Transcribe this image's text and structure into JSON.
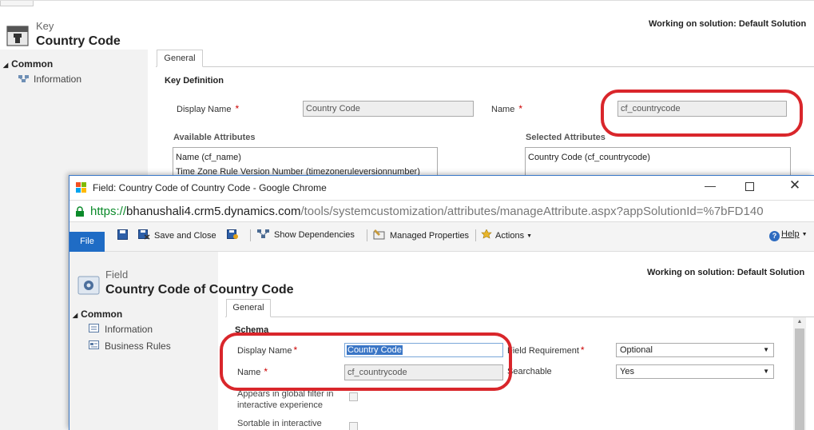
{
  "bg": {
    "entity_label": "Key",
    "title": "Country Code",
    "solution_text": "Working on solution: Default Solution",
    "nav_section": "Common",
    "nav_items": [
      "Information"
    ],
    "tab": "General",
    "section_title": "Key Definition",
    "display_name_label": "Display Name",
    "display_name_value": "Country Code",
    "name_label": "Name",
    "name_value": "cf_countrycode",
    "available_label": "Available Attributes",
    "available_items": [
      "Name (cf_name)",
      "Time Zone Rule Version Number (timezoneruleversionnumber)"
    ],
    "selected_label": "Selected Attributes",
    "selected_items": [
      "Country Code (cf_countrycode)"
    ],
    "required_marker": "*"
  },
  "popup": {
    "window_title": "Field: Country Code of Country Code - Google Chrome",
    "url_scheme": "https://",
    "url_host": "bhanushali4.crm5.dynamics.com",
    "url_path": "/tools/systemcustomization/attributes/manageAttribute.aspx?appSolutionId=%7bFD140",
    "toolbar": {
      "file": "File",
      "save_close": "Save and Close",
      "show_dependencies": "Show Dependencies",
      "managed_properties": "Managed Properties",
      "actions": "Actions",
      "help": "Help"
    },
    "entity_label": "Field",
    "title": "Country Code of Country Code",
    "solution_text": "Working on solution: Default Solution",
    "nav_section": "Common",
    "nav_items": [
      "Information",
      "Business Rules"
    ],
    "tab": "General",
    "section_title": "Schema",
    "display_name_label": "Display Name",
    "display_name_value": "Country Code",
    "name_label": "Name",
    "name_value": "cf_countrycode",
    "field_requirement_label": "Field Requirement",
    "field_requirement_value": "Optional",
    "searchable_label": "Searchable",
    "searchable_value": "Yes",
    "global_filter_label": "Appears in global filter in interactive experience",
    "sortable_label": "Sortable in interactive",
    "required_marker": "*"
  },
  "colors": {
    "accent_blue": "#1f6cc5",
    "highlight_red": "#d9262b",
    "url_green": "#0b8a2a"
  }
}
